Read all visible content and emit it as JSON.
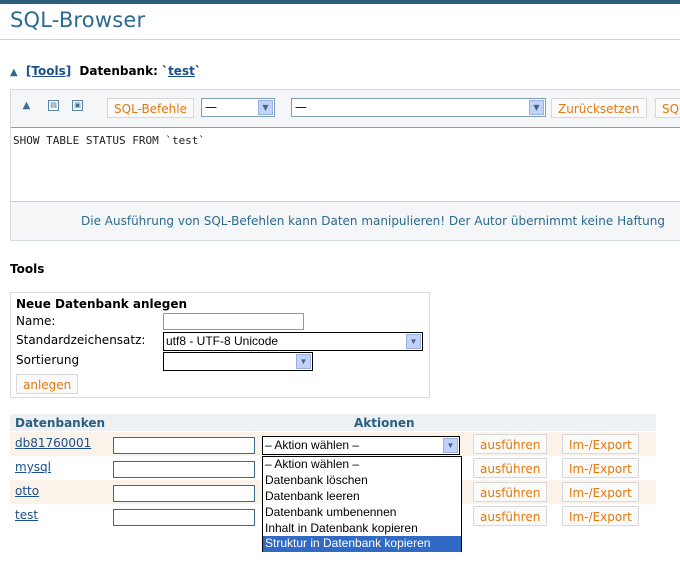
{
  "app": {
    "title": "SQL-Browser"
  },
  "breadcrumb": {
    "tools_link": "[Tools]",
    "db_label": "Datenbank: `",
    "db_name": "test",
    "db_suffix": "`"
  },
  "sql_toolbar": {
    "icons": [
      "up-arrow-icon",
      "collapse-icon",
      "expand-icon"
    ],
    "sql_commands_label": "SQL-Befehle",
    "select1_value": "—",
    "select2_value": "—",
    "reset_label": "Zurücksetzen",
    "cut_label": "SQ"
  },
  "sql_editor": {
    "value": "SHOW TABLE STATUS FROM `test`"
  },
  "warning": "Die Ausführung von SQL-Befehlen kann Daten manipulieren! Der Autor übernimmt keine Haftung",
  "tools_heading": "Tools",
  "new_db": {
    "heading": "Neue Datenbank anlegen",
    "name_label": "Name:",
    "charset_label": "Standardzeichensatz:",
    "charset_value": "utf8 - UTF-8 Unicode",
    "collation_label": "Sortierung",
    "collation_value": "",
    "create_label": "anlegen"
  },
  "db_table": {
    "col_db": "Datenbanken",
    "col_actions": "Aktionen",
    "rows": [
      {
        "name": "db81760001"
      },
      {
        "name": "mysql"
      },
      {
        "name": "otto"
      },
      {
        "name": "test"
      }
    ],
    "execute_label": "ausführen",
    "import_export_label": "Im-/Export",
    "action_select_value": "– Aktion wählen –"
  },
  "action_dropdown": {
    "options": [
      "– Aktion wählen –",
      "Datenbank löschen",
      "Datenbank leeren",
      "Datenbank umbenennen",
      "Inhalt in Datenbank kopieren",
      "Struktur in Datenbank kopieren"
    ],
    "highlighted": "Struktur in Datenbank kopieren"
  },
  "colors": {
    "accent": "#2b6a8f",
    "button_text": "#e07a10",
    "highlight": "#316ac5"
  }
}
